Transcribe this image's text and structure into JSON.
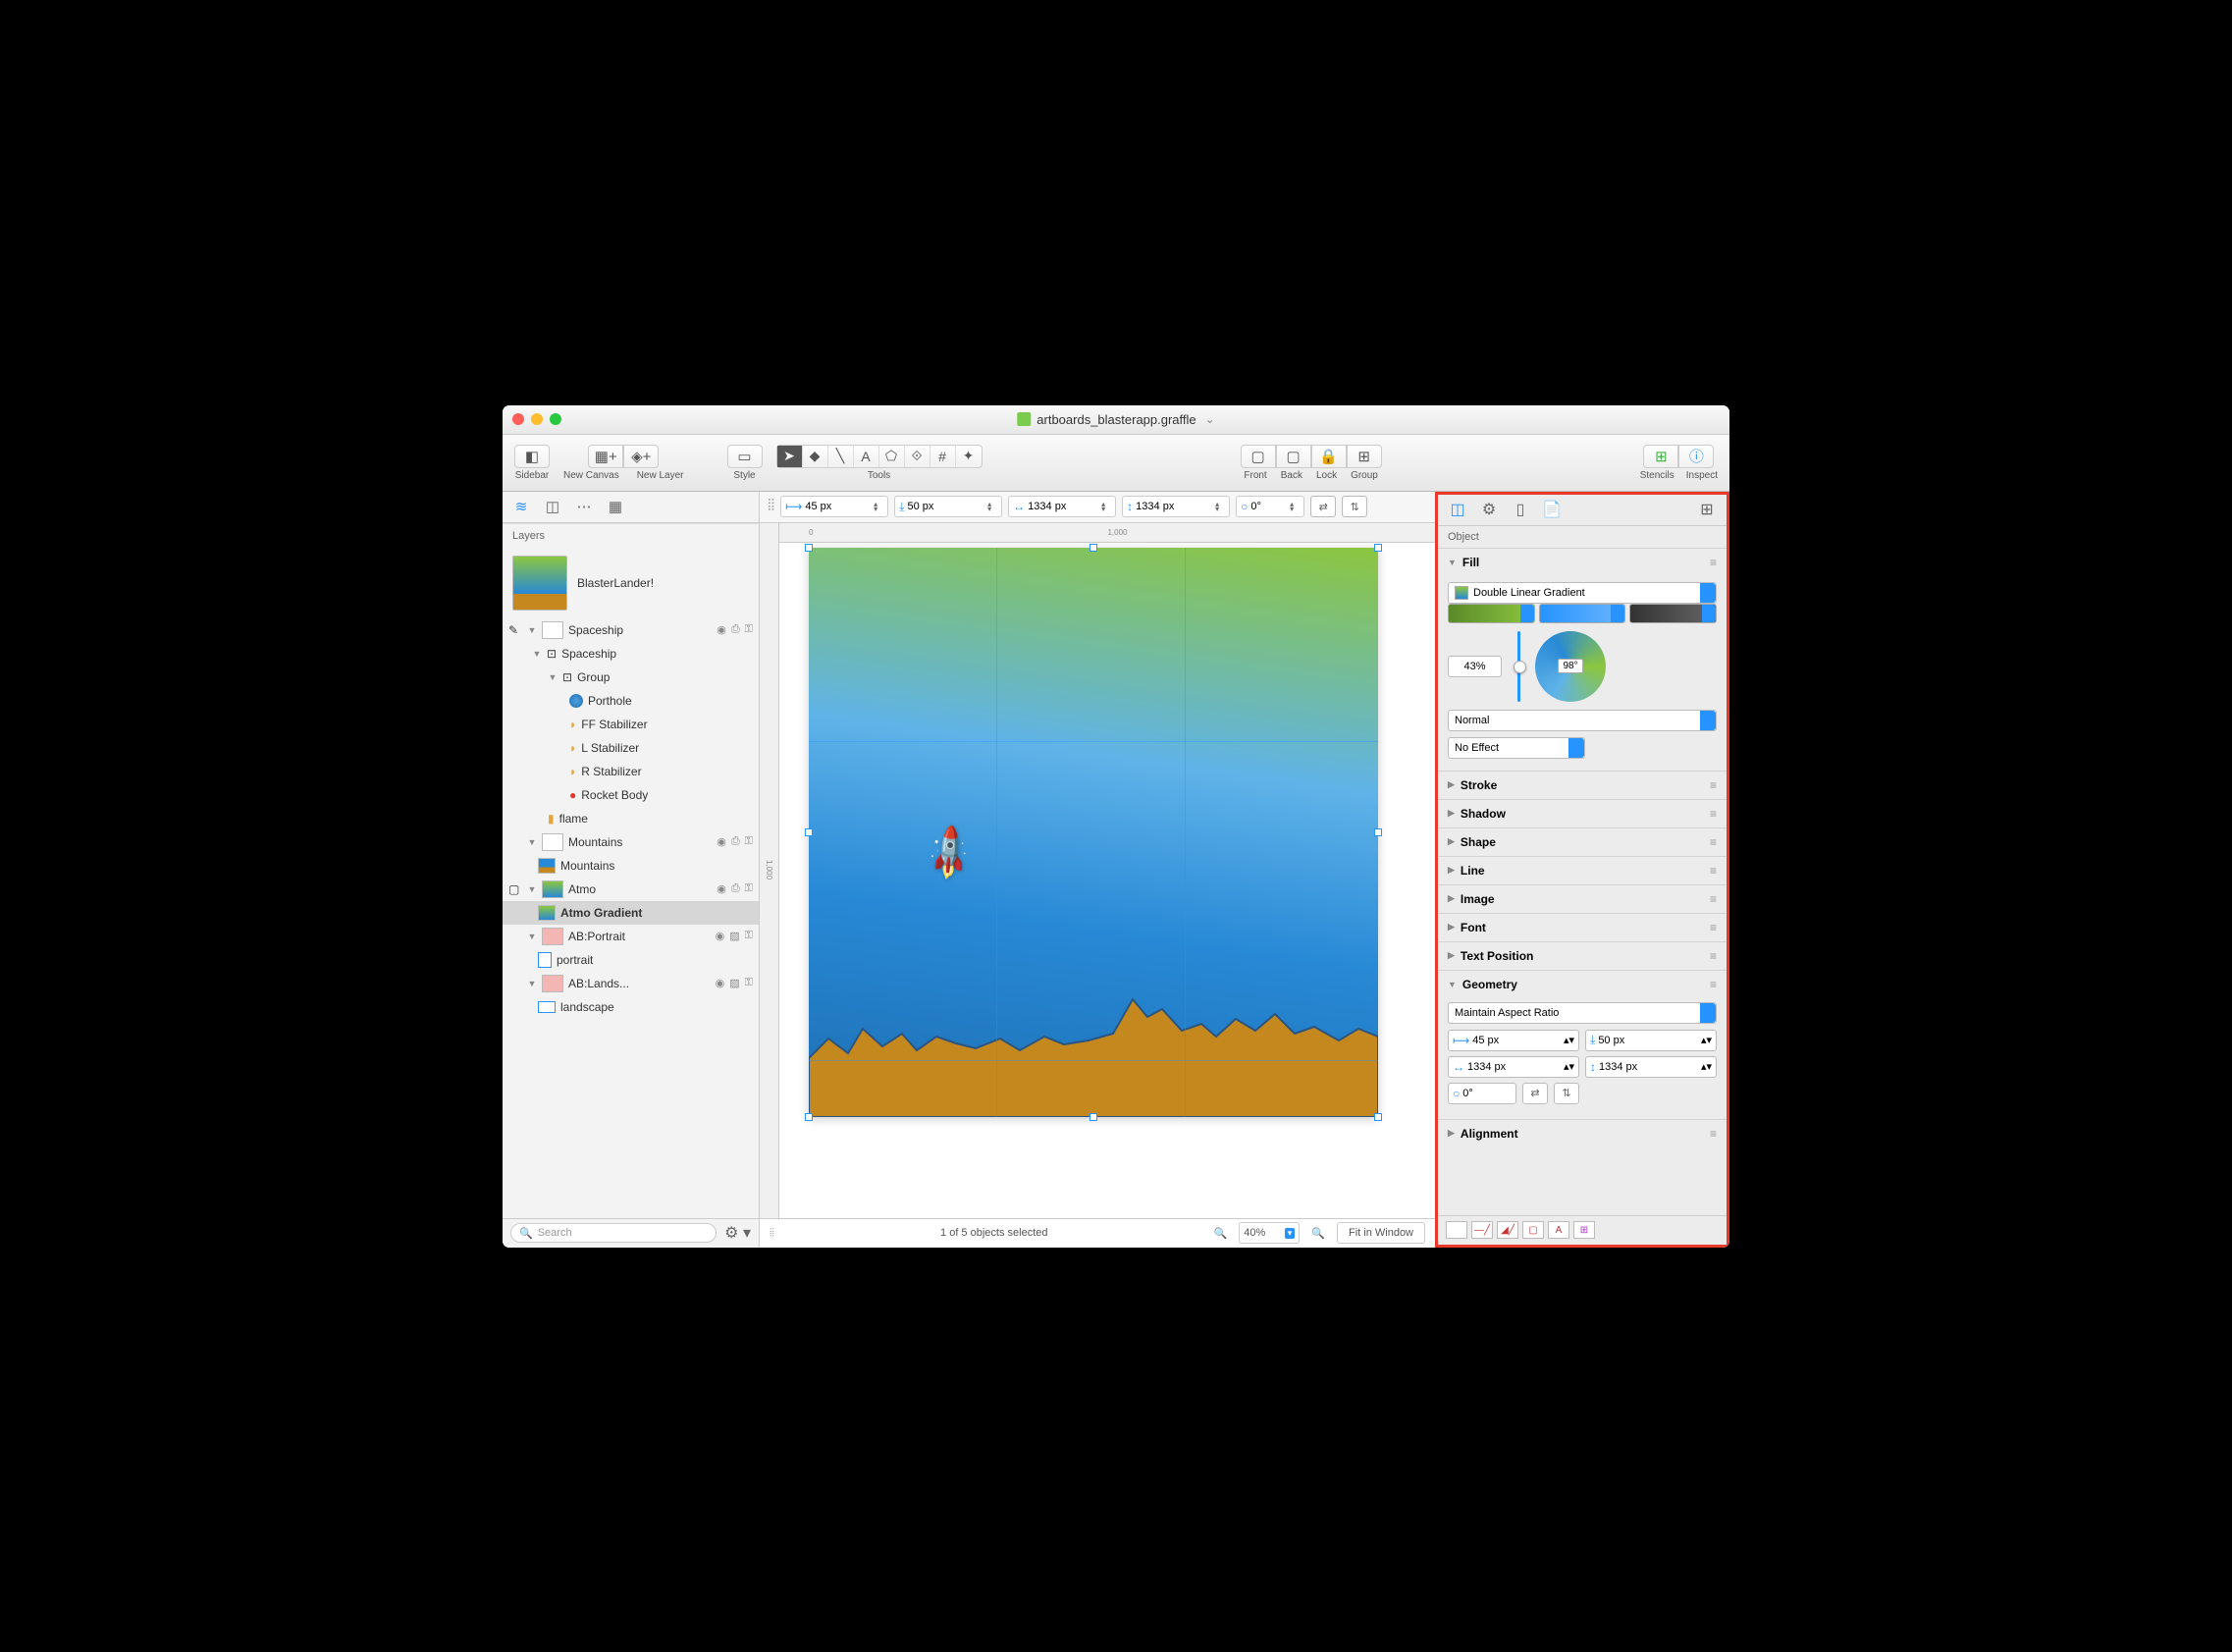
{
  "window": {
    "title": "artboards_blasterapp.graffle"
  },
  "toolbar": {
    "sidebar": "Sidebar",
    "new_canvas": "New Canvas",
    "new_layer": "New Layer",
    "style": "Style",
    "tools": "Tools",
    "front": "Front",
    "back": "Back",
    "lock": "Lock",
    "group": "Group",
    "stencils": "Stencils",
    "inspect": "Inspect"
  },
  "geometry_bar": {
    "x": "45 px",
    "y": "50 px",
    "w": "1334 px",
    "h": "1334 px",
    "angle": "0°"
  },
  "ruler": {
    "zero": "0",
    "thousand": "1,000",
    "v1000": "1,000"
  },
  "sidebar": {
    "header": "Layers",
    "canvas_name": "BlasterLander!",
    "search_placeholder": "Search",
    "layers": {
      "spaceship": "Spaceship",
      "spaceship_group": "Spaceship",
      "group": "Group",
      "porthole": "Porthole",
      "ff_stab": "FF Stabilizer",
      "l_stab": "L Stabilizer",
      "r_stab": "R Stabilizer",
      "rocket_body": "Rocket Body",
      "flame": "flame",
      "mountains": "Mountains",
      "mountains_obj": "Mountains",
      "atmo": "Atmo",
      "atmo_grad": "Atmo Gradient",
      "ab_portrait": "AB:Portrait",
      "portrait": "portrait",
      "ab_landscape": "AB:Lands...",
      "landscape": "landscape"
    }
  },
  "canvas": {
    "status": "1 of 5 objects selected",
    "zoom": "40%",
    "fit": "Fit in Window"
  },
  "inspector": {
    "header": "Object",
    "sections": {
      "fill": "Fill",
      "stroke": "Stroke",
      "shadow": "Shadow",
      "shape": "Shape",
      "line": "Line",
      "image": "Image",
      "font": "Font",
      "text_pos": "Text Position",
      "geometry": "Geometry",
      "alignment": "Alignment"
    },
    "fill": {
      "type": "Double Linear Gradient",
      "pct": "43%",
      "angle": "98°",
      "blend": "Normal",
      "effect": "No Effect",
      "colors": {
        "a": "#8cc63f",
        "b": "#2693ff",
        "c": "#444444"
      }
    },
    "geometry": {
      "aspect": "Maintain Aspect Ratio",
      "x": "45 px",
      "y": "50 px",
      "w": "1334 px",
      "h": "1334 px",
      "angle": "0°"
    }
  }
}
